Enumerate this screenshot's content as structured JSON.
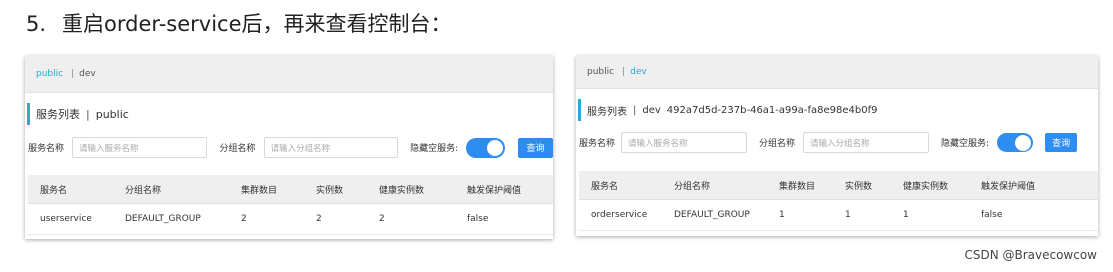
{
  "heading": {
    "number": "5.",
    "text": "重启order-service后，再来查看控制台："
  },
  "panels": [
    {
      "namespaces": [
        "public",
        "dev"
      ],
      "active_namespace": "public",
      "title": "服务列表",
      "namespace_label": "public",
      "namespace_id": "",
      "search": {
        "service_name_label": "服务名称",
        "service_name_placeholder": "请输入服务名称",
        "group_label": "分组名称",
        "group_placeholder": "请输入分组名称",
        "hide_empty_label": "隐藏空服务:",
        "hide_empty_on": true,
        "query_button": "查询"
      },
      "table": {
        "headers": [
          "服务名",
          "分组名称",
          "集群数目",
          "实例数",
          "健康实例数",
          "触发保护阈值"
        ],
        "rows": [
          [
            "userservice",
            "DEFAULT_GROUP",
            "2",
            "2",
            "2",
            "false"
          ]
        ]
      }
    },
    {
      "namespaces": [
        "public",
        "dev"
      ],
      "active_namespace": "dev",
      "title": "服务列表",
      "namespace_label": "dev",
      "namespace_id": "492a7d5d-237b-46a1-a99a-fa8e98e4b0f9",
      "search": {
        "service_name_label": "服务名称",
        "service_name_placeholder": "请输入服务名称",
        "group_label": "分组名称",
        "group_placeholder": "请输入分组名称",
        "hide_empty_label": "隐藏空服务:",
        "hide_empty_on": true,
        "query_button": "查询"
      },
      "table": {
        "headers": [
          "服务名",
          "分组名称",
          "集群数目",
          "实例数",
          "健康实例数",
          "触发保护阈值"
        ],
        "rows": [
          [
            "orderservice",
            "DEFAULT_GROUP",
            "1",
            "1",
            "1",
            "false"
          ]
        ]
      }
    }
  ],
  "watermark": "CSDN @Bravecowcow",
  "colors": {
    "accent": "#2fa5d8",
    "primary_button": "#2f8cf0",
    "header_bg": "#efefef"
  }
}
